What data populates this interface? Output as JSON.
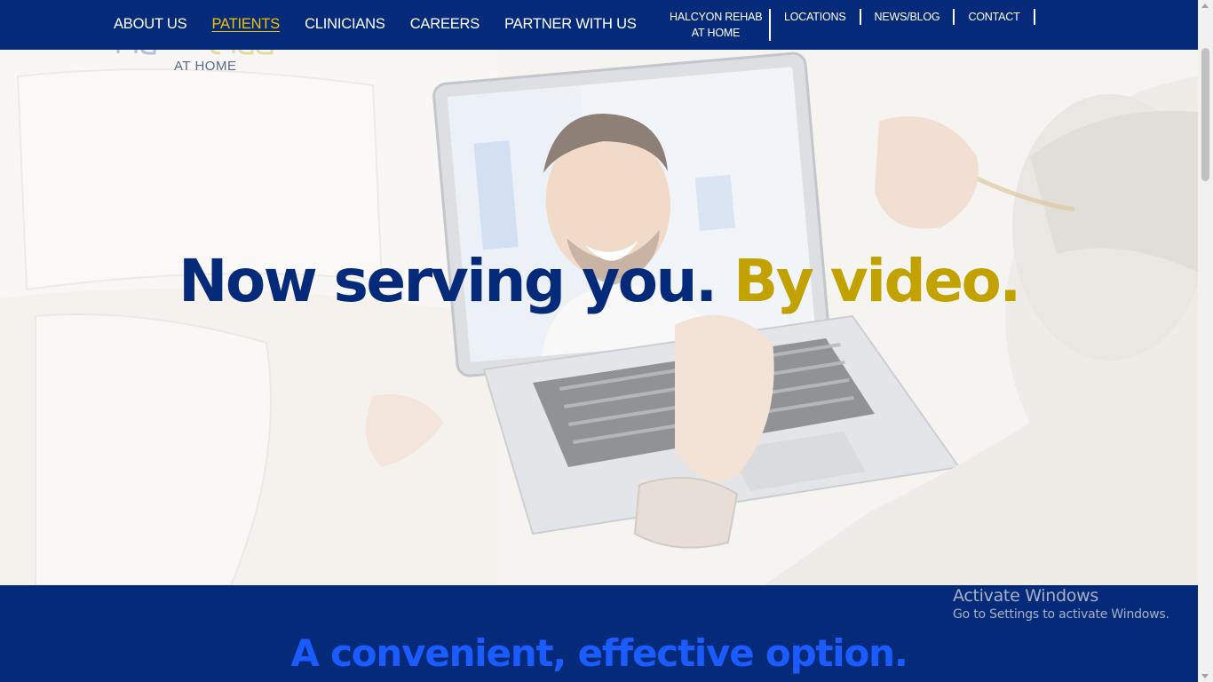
{
  "nav": {
    "main": [
      {
        "label": "ABOUT US",
        "active": false
      },
      {
        "label": "PATIENTS",
        "active": true
      },
      {
        "label": "CLINICIANS",
        "active": false
      },
      {
        "label": "CAREERS",
        "active": false
      },
      {
        "label": "PARTNER WITH US",
        "active": false
      }
    ],
    "utility": {
      "brand_line1": "HALCYON REHAB",
      "brand_line2": "AT HOME",
      "locations": "LOCATIONS",
      "news": "NEWS/BLOG",
      "contact": "CONTACT"
    }
  },
  "logo": {
    "sub": "AT HOME"
  },
  "hero": {
    "headline_part1": "Now serving you. ",
    "headline_part2": "By video.",
    "image": "telehealth-video-call-photo"
  },
  "section": {
    "headline": "A convenient, effective option."
  },
  "watermark": {
    "line1": "Activate Windows",
    "line2": "Go to Settings to activate Windows."
  },
  "colors": {
    "navy": "#062a7a",
    "gold": "#c2a200",
    "active_nav": "#f2c200",
    "accent_blue": "#1a5cff"
  }
}
